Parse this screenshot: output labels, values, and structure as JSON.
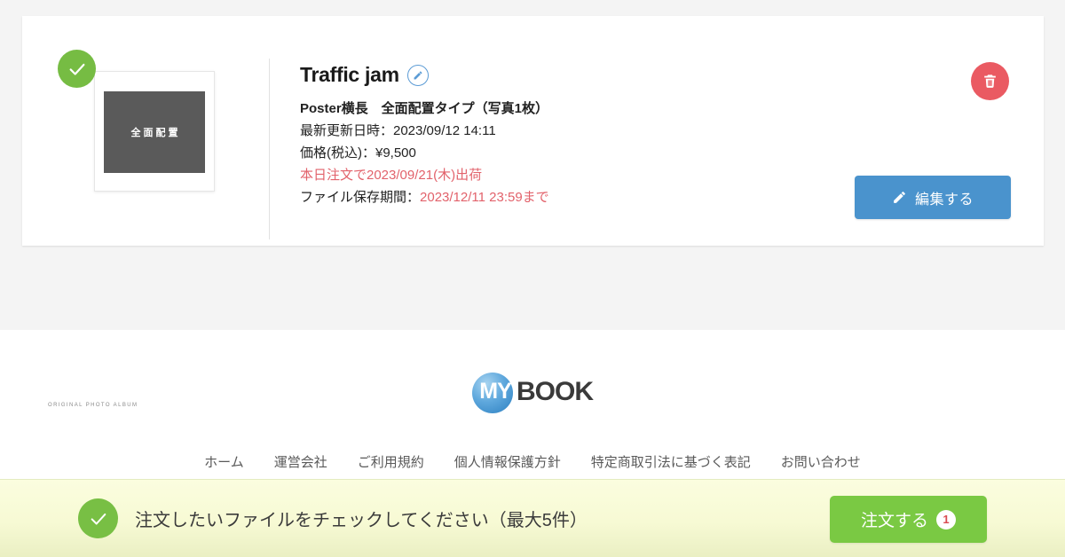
{
  "item": {
    "title": "Traffic jam",
    "edit_title_icon": "pencil-circle-icon",
    "thumbnail_label": "全面配置",
    "selected": true,
    "product_line": "Poster横長　全面配置タイプ（写真1枚）",
    "updated_line": "最新更新日時：2023/09/12 14:11",
    "price_line": "価格(税込)：¥9,500",
    "shipping_line": "本日注文で2023/09/21(木)出荷",
    "storage_label": "ファイル保存期間：",
    "storage_value": "2023/12/11 23:59まで",
    "delete_icon": "trash-icon",
    "edit_button_label": "編集する",
    "edit_button_icon": "pencil-icon"
  },
  "footer": {
    "logo_my": "MY",
    "logo_book": "BOOK",
    "logo_tagline": "ORIGINAL PHOTO ALBUM",
    "links": [
      {
        "label": "ホーム"
      },
      {
        "label": "運営会社"
      },
      {
        "label": "ご利用規約"
      },
      {
        "label": "個人情報保護方針"
      },
      {
        "label": "特定商取引法に基づく表記"
      },
      {
        "label": "お問い合わせ"
      }
    ]
  },
  "bottom_bar": {
    "check_icon": "check-icon",
    "message": "注文したいファイルをチェックしてください（最大5件）",
    "order_button_label": "注文する",
    "order_count": "1"
  },
  "colors": {
    "page_background": "#f4f4f4",
    "card_background": "#ffffff",
    "accent_green": "#76bc43",
    "accent_blue": "#4a93cd",
    "accent_red": "#ea5a62",
    "alert_text_red": "#e2626b",
    "order_green": "#7ac943",
    "bottom_bar_yellow": "#f7fad4"
  }
}
